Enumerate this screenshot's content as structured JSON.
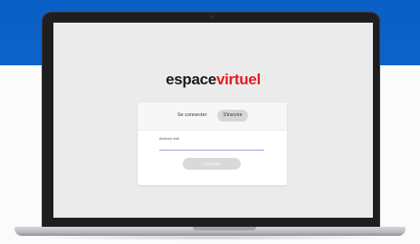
{
  "logo": {
    "part1": "espace",
    "part2": "virtuel",
    "part2_color": "#e31b23"
  },
  "tabs": {
    "login": "Se connecter",
    "signup": "S'inscrire",
    "active": "signup"
  },
  "form": {
    "email_label": "Adresse mail",
    "email_value": "",
    "submit_label": "S'inscrire"
  },
  "colors": {
    "banner": "#0a5fc4",
    "screen_bg": "#ecebec",
    "brand_red": "#e31b23"
  }
}
